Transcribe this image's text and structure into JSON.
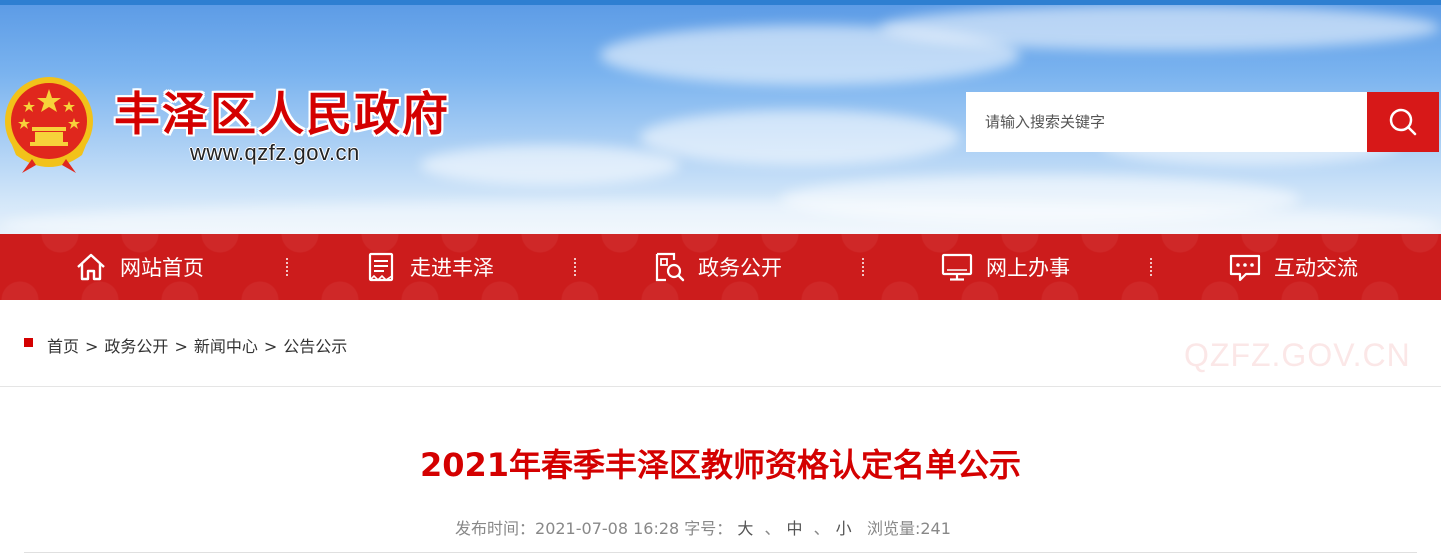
{
  "header": {
    "site_name": "丰泽区人民政府",
    "site_url": "www.qzfz.gov.cn",
    "search_placeholder": "请输入搜索关键字"
  },
  "nav": {
    "items": [
      {
        "label": "网站首页",
        "icon": "home-icon"
      },
      {
        "label": "走进丰泽",
        "icon": "document-icon"
      },
      {
        "label": "政务公开",
        "icon": "search-doc-icon"
      },
      {
        "label": "网上办事",
        "icon": "monitor-icon"
      },
      {
        "label": "互动交流",
        "icon": "chat-icon"
      }
    ]
  },
  "breadcrumb": {
    "items": [
      "首页",
      "政务公开",
      "新闻中心",
      "公告公示"
    ],
    "separator": ">"
  },
  "watermark": "QZFZ.GOV.CN",
  "article": {
    "title": "2021年春季丰泽区教师资格认定名单公示",
    "publish_label": "发布时间：",
    "publish_time": "2021-07-08 16:28",
    "font_size_label": "字号：",
    "font_size_large": "大",
    "font_size_medium": "中",
    "font_size_small": "小",
    "font_size_sep": "、",
    "views_label": "浏览量:",
    "views": "241"
  },
  "colors": {
    "brand_red": "#d40000",
    "nav_red": "#cc1c1c",
    "search_button": "#d71818"
  }
}
